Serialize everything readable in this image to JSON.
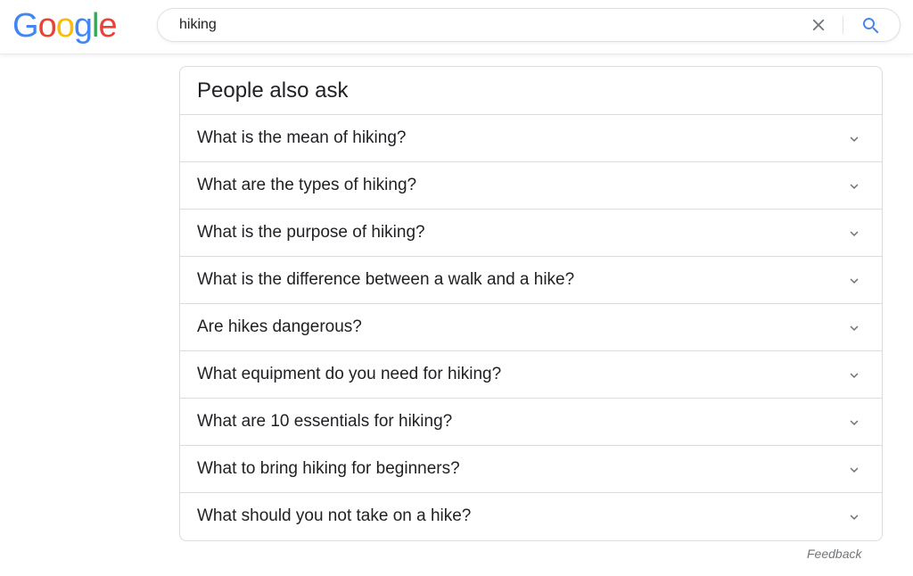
{
  "header": {
    "logo": {
      "letters": [
        "G",
        "o",
        "o",
        "g",
        "l",
        "e"
      ],
      "colors": [
        "#4285F4",
        "#EA4335",
        "#FBBC05",
        "#4285F4",
        "#34A853",
        "#EA4335"
      ]
    },
    "search": {
      "value": "hiking",
      "clear_icon": "close-icon",
      "search_icon": "search-icon"
    }
  },
  "paa": {
    "title": "People also ask",
    "items": [
      {
        "question": "What is the mean of hiking?",
        "icon": "chevron-down-icon"
      },
      {
        "question": "What are the types of hiking?",
        "icon": "chevron-down-icon"
      },
      {
        "question": "What is the purpose of hiking?",
        "icon": "chevron-down-icon"
      },
      {
        "question": "What is the difference between a walk and a hike?",
        "icon": "chevron-down-icon"
      },
      {
        "question": "Are hikes dangerous?",
        "icon": "chevron-down-icon"
      },
      {
        "question": "What equipment do you need for hiking?",
        "icon": "chevron-down-icon"
      },
      {
        "question": "What are 10 essentials for hiking?",
        "icon": "chevron-down-icon"
      },
      {
        "question": "What to bring hiking for beginners?",
        "icon": "chevron-down-icon"
      },
      {
        "question": "What should you not take on a hike?",
        "icon": "chevron-down-icon"
      }
    ]
  },
  "feedback_label": "Feedback",
  "colors": {
    "text": "#202124",
    "border": "#dadce0",
    "icon_gray": "#70757a",
    "search_blue": "#4285F4"
  }
}
